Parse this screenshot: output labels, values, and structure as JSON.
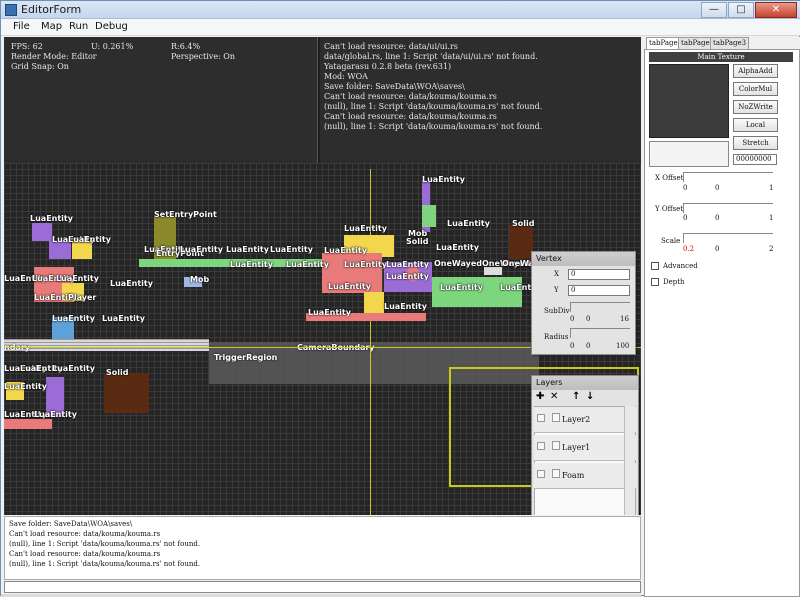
{
  "window": {
    "title": "EditorForm",
    "minimize": "—",
    "maximize": "□",
    "close": "✕"
  },
  "menu": [
    "File",
    "Map",
    "Run",
    "Debug"
  ],
  "stats": {
    "fps": "FPS: 62",
    "u": "U: 0.261%",
    "r": "R:6.4%",
    "render_mode": "Render Mode: Editor",
    "perspective": "Perspective: On",
    "grid_snap": "Grid Snap: On"
  },
  "viewport_log": [
    "Can't load resource: data/ui/ui.rs",
    "data/global.rs, line 1: Script 'data/ui/ui.rs' not found.",
    "Yatagarasu 0.2.8 beta (rev.631)",
    "Mod: WOA",
    "Save folder: SaveData\\WOA\\saves\\",
    "Can't load resource: data/kouma/kouma.rs",
    "(null), line 1: Script 'data/kouma/kouma.rs' not found.",
    "Can't load resource: data/kouma/kouma.rs",
    "(null), line 1: Script 'data/kouma/kouma.rs' not found."
  ],
  "scene": {
    "lua_entity": "LuaEntity",
    "set_entry_point": "SetEntryPoint",
    "entry_point": "EntryPoint",
    "player": "Player",
    "mob": "Mob",
    "solid": "Solid",
    "one_way": "OneWayedOneWayed",
    "trigger_region": "TriggerRegion",
    "camera_boundary": "CameraBoundary",
    "boundary": "ndary"
  },
  "vertex_panel": {
    "title": "Vertex",
    "x_label": "X",
    "x_value": "0",
    "y_label": "Y",
    "y_value": "0",
    "subdiv_label": "SubDiv",
    "subdiv_min": "0",
    "subdiv_value": "0",
    "subdiv_max": "16",
    "radius_label": "Radius",
    "radius_min": "0",
    "radius_value": "0",
    "radius_max": "100"
  },
  "layers_panel": {
    "title": "Layers",
    "add": "✚",
    "remove": "✕",
    "up": "↑",
    "down": "↓",
    "layers": [
      "Layer2",
      "Layer1",
      "Foam"
    ]
  },
  "sidebar": {
    "tabs": [
      "tabPage1",
      "tabPage2",
      "tabPage3"
    ],
    "main_texture": "Main Texture",
    "buttons": [
      "AlphaAdd",
      "ColorMul",
      "NoZWrite",
      "Local",
      "Stretch"
    ],
    "color_value": "00000000",
    "x_offset": {
      "label": "X Offset",
      "min": "0",
      "value": "0",
      "max": "1"
    },
    "y_offset": {
      "label": "Y Offset",
      "min": "0",
      "value": "0",
      "max": "1"
    },
    "scale": {
      "label": "Scale",
      "min": "0.2",
      "value": "0",
      "max": "2"
    },
    "advanced": "Advanced",
    "depth": "Depth"
  },
  "console": [
    "Save folder: SaveData\\WOA\\saves\\",
    "Can't load resource: data/kouma/kouma.rs",
    "(null), line 1: Script 'data/kouma/kouma.rs' not found.",
    "Can't load resource: data/kouma/kouma.rs",
    "(null), line 1: Script 'data/kouma/kouma.rs' not found."
  ],
  "colors": {
    "accent_red": "#e00000",
    "trigger_yellow": "#c8c81e"
  }
}
